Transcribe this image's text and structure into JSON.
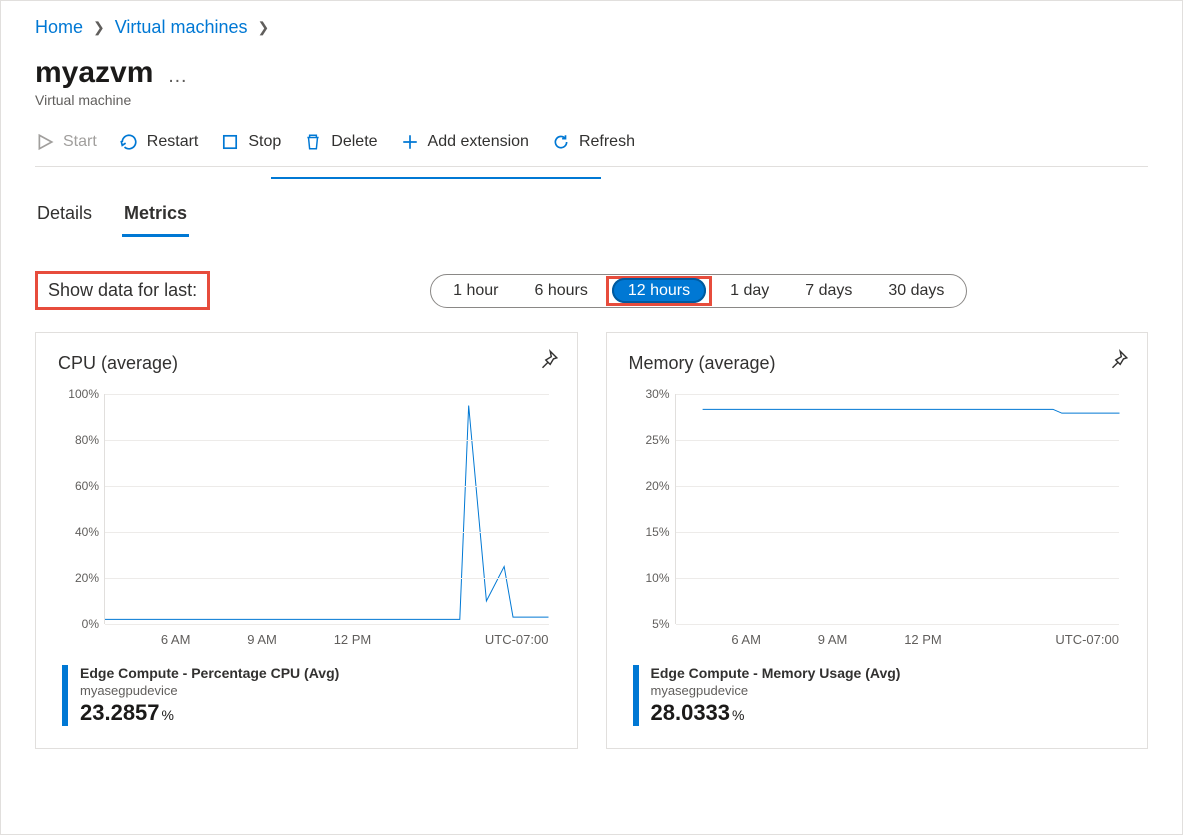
{
  "breadcrumb": {
    "home": "Home",
    "vms": "Virtual machines"
  },
  "page": {
    "title": "myazvm",
    "subtitle": "Virtual machine"
  },
  "toolbar": {
    "start": "Start",
    "restart": "Restart",
    "stop": "Stop",
    "delete": "Delete",
    "add_ext": "Add extension",
    "refresh": "Refresh"
  },
  "tabs": {
    "details": "Details",
    "metrics": "Metrics"
  },
  "filter": {
    "label": "Show data for last:",
    "options": [
      "1 hour",
      "6 hours",
      "12 hours",
      "1 day",
      "7 days",
      "30 days"
    ],
    "selected_index": 2
  },
  "cards": {
    "cpu": {
      "title": "CPU (average)",
      "legend_title": "Edge Compute - Percentage CPU (Avg)",
      "legend_sub": "myasegpudevice",
      "value": "23.2857",
      "unit": "%",
      "yticks": [
        "100%",
        "80%",
        "60%",
        "40%",
        "20%",
        "0%"
      ],
      "xticks": [
        "",
        "6 AM",
        "9 AM",
        "12 PM",
        ""
      ],
      "tz_label": "UTC-07:00"
    },
    "mem": {
      "title": "Memory (average)",
      "legend_title": "Edge Compute - Memory Usage (Avg)",
      "legend_sub": "myasegpudevice",
      "value": "28.0333",
      "unit": "%",
      "yticks": [
        "30%",
        "25%",
        "20%",
        "15%",
        "10%",
        "5%"
      ],
      "xticks": [
        "",
        "6 AM",
        "9 AM",
        "12 PM",
        ""
      ],
      "tz_label": "UTC-07:00"
    }
  },
  "chart_data": [
    {
      "type": "line",
      "title": "CPU (average)",
      "ylabel": "Percentage CPU",
      "ylim": [
        0,
        100
      ],
      "x": [
        0,
        0.8,
        0.82,
        0.86,
        0.9,
        0.92,
        1.0
      ],
      "values": [
        2,
        2,
        95,
        10,
        25,
        3,
        3
      ],
      "xticks": [
        "6 AM",
        "9 AM",
        "12 PM"
      ],
      "tz": "UTC-07:00",
      "window": "12 hours"
    },
    {
      "type": "line",
      "title": "Memory (average)",
      "ylabel": "Memory Usage %",
      "ylim": [
        0,
        30
      ],
      "x": [
        0.06,
        0.85,
        0.87,
        1.0
      ],
      "values": [
        28,
        28,
        27.5,
        27.5
      ],
      "xticks": [
        "6 AM",
        "9 AM",
        "12 PM"
      ],
      "tz": "UTC-07:00",
      "window": "12 hours"
    }
  ]
}
